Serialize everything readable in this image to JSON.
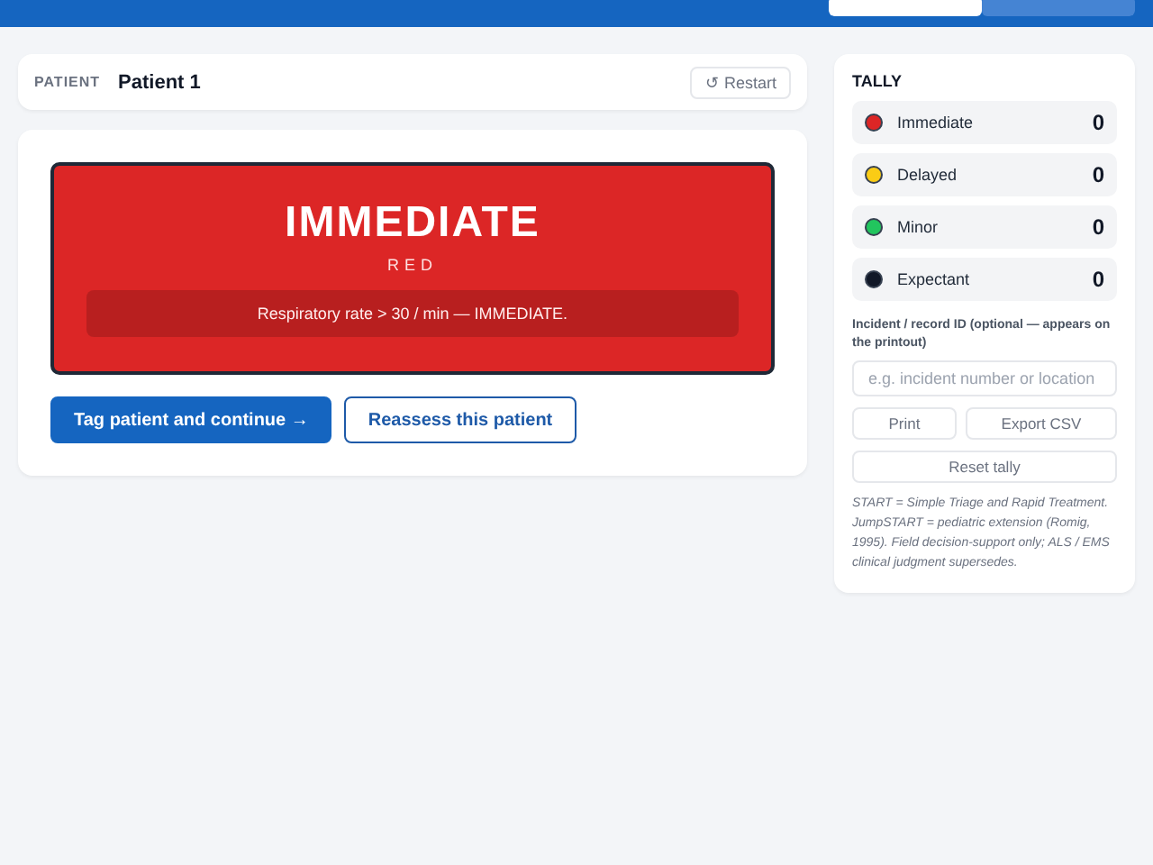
{
  "header": {
    "mode_toggle": [
      {
        "selected": true
      },
      {
        "selected": false
      }
    ]
  },
  "patient": {
    "label": "PATIENT",
    "name": "Patient 1",
    "restart": "↺ Restart"
  },
  "result": {
    "category": "IMMEDIATE",
    "tag_color": "RED",
    "color": "#dc2626",
    "reason": "Respiratory rate > 30 / min — IMMEDIATE."
  },
  "actions": [
    {
      "label": "Tag patient and continue →",
      "kind": "primary"
    },
    {
      "label": "Reassess this patient",
      "kind": "secondary"
    }
  ],
  "tally": {
    "title": "TALLY",
    "items": [
      {
        "name": "Immediate",
        "count": "0",
        "color": "#dc2626"
      },
      {
        "name": "Delayed",
        "count": "0",
        "color": "#facc15"
      },
      {
        "name": "Minor",
        "count": "0",
        "color": "#22c55e"
      },
      {
        "name": "Expectant",
        "count": "0",
        "color": "#111827"
      }
    ],
    "record_label": "Incident / record ID (optional — appears on the printout)",
    "record_placeholder": "e.g. incident number or location",
    "buttons": [
      "Print",
      "Export CSV"
    ],
    "reset": "Reset tally",
    "note": "START = Simple Triage and Rapid Treatment. JumpSTART = pediatric extension (Romig, 1995). Field decision-support only; ALS / EMS clinical judgment supersedes."
  }
}
